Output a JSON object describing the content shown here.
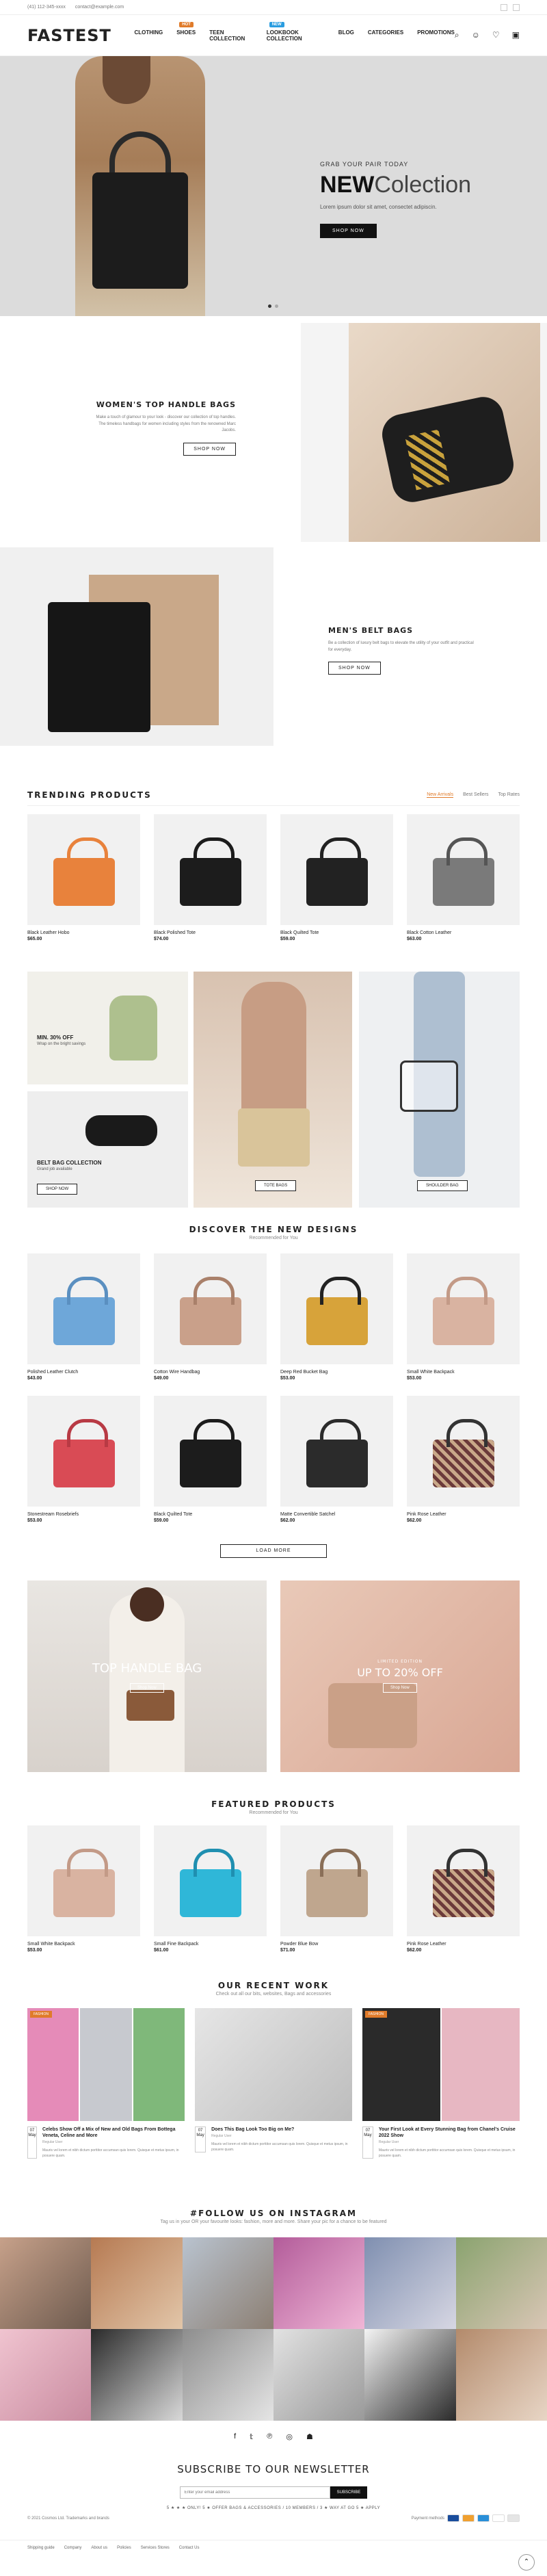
{
  "topbar": {
    "phone": "(41) 112-345-xxxx",
    "email": "contact@example.com"
  },
  "header": {
    "logo": "FASTEST",
    "nav": [
      {
        "label": "Clothing",
        "badge": ""
      },
      {
        "label": "Shoes",
        "badge": "HOT",
        "badge_color": "#e07b2a"
      },
      {
        "label": "Teen Collection",
        "badge": ""
      },
      {
        "label": "Lookbook Collection",
        "badge": "NEW",
        "badge_color": "#2a9de0"
      },
      {
        "label": "Blog",
        "badge": ""
      },
      {
        "label": "Categories",
        "badge": ""
      },
      {
        "label": "Promotions",
        "badge": ""
      }
    ],
    "icons": [
      "search-icon",
      "user-icon",
      "heart-icon",
      "cart-icon"
    ]
  },
  "hero": {
    "kicker": "GRAB YOUR PAIR TODAY",
    "title_bold": "NEW",
    "title_rest": "Colection",
    "text": "Lorem ipsum dolor sit amet, consectet adipiscin.",
    "button": "Shop Now"
  },
  "promo1": {
    "title": "WOMEN'S TOP HANDLE BAGS",
    "text": "Make a touch of glamour to your look - discover our collection of top handles. The timeless handbags for women including styles from the renowned Marc Jacobs.",
    "button": "Shop Now"
  },
  "promo2": {
    "title": "MEN'S BELT BAGS",
    "text": "Be a collection of luxury belt bags to elevate the utility of your outfit and practical for everyday.",
    "button": "Shop Now"
  },
  "trending": {
    "title": "TRENDING PRODUCTS",
    "tabs": [
      "New Arrivals",
      "Best Sellers",
      "Top Rates"
    ],
    "products": [
      {
        "name": "Black Leather Hobo",
        "price": "$65.00",
        "color": "#e8823c"
      },
      {
        "name": "Black Polished Tote",
        "price": "$74.00",
        "color": "#1c1c1c"
      },
      {
        "name": "Black Quilted Tote",
        "price": "$59.00",
        "color": "#222222"
      },
      {
        "name": "Black Cotton Leather",
        "price": "$63.00",
        "color": "#7a7a7a"
      }
    ]
  },
  "mosaic": {
    "tile1": {
      "title": "MIN. 30% OFF",
      "sub": "Wrap on the bright savings"
    },
    "tile2": {
      "title": "BELT BAG COLLECTION",
      "sub": "Grand job available",
      "button": "Shop Now"
    },
    "tile3": {
      "button": "Tote Bags"
    },
    "tile4": {
      "button": "Shoulder Bag"
    }
  },
  "discover": {
    "title": "DISCOVER THE NEW DESIGNS",
    "subtitle": "Recommended for You",
    "products": [
      {
        "name": "Polished Leather Clutch",
        "price": "$43.00",
        "color": "#6ea7d9"
      },
      {
        "name": "Cotton Wire Handbag",
        "price": "$49.00",
        "color": "#c9a08a"
      },
      {
        "name": "Deep Red Bucket Bag",
        "price": "$53.00",
        "color": "#d7a33a"
      },
      {
        "name": "Small White Backpack",
        "price": "$53.00",
        "color": "#d9b3a1"
      },
      {
        "name": "Stonestream Rosebriefs",
        "price": "$53.00",
        "color": "#d94b55"
      },
      {
        "name": "Black Quilted Tote",
        "price": "$59.00",
        "color": "#1c1c1c"
      },
      {
        "name": "Matte Convertible Satchel",
        "price": "$62.00",
        "color": "#2b2b2b"
      },
      {
        "name": "Pink Rose Leather",
        "price": "$62.00",
        "color": "#6b3a3a"
      }
    ],
    "load_more": "Load More"
  },
  "banners": {
    "left": {
      "title": "TOP HANDLE BAG",
      "button": "Shop Now"
    },
    "right": {
      "kicker": "LIMITED EDITION",
      "title": "UP TO 20% OFF",
      "button": "Shop Now"
    }
  },
  "featured": {
    "title": "FEATURED PRODUCTS",
    "subtitle": "Recommended for You",
    "products": [
      {
        "name": "Small White Backpack",
        "price": "$53.00",
        "color": "#d9b3a1"
      },
      {
        "name": "Small Fine Backpack",
        "price": "$61.00",
        "color": "#2fb7d8"
      },
      {
        "name": "Powder Blue Bow",
        "price": "$71.00",
        "color": "#bfa68e"
      },
      {
        "name": "Pink Rose Leather",
        "price": "$62.00",
        "color": "#6b3a3a"
      }
    ]
  },
  "blog": {
    "title": "OUR RECENT WORK",
    "subtitle": "Check out all our bits, websites, Bags and accessories",
    "posts": [
      {
        "tag": "FASHION",
        "day": "07",
        "month": "May",
        "title": "Celebs Show Off a Mix of New and Old Bags From Bottega Veneta, Celine and More",
        "by": "Regular User",
        "excerpt": "Mauris vel lorem et nibh dictum porttitor accumsan quis lorem. Quisque et metus ipsum, in posuere quam."
      },
      {
        "tag": "",
        "day": "07",
        "month": "May",
        "title": "Does This Bag Look Too Big on Me?",
        "by": "Regular User",
        "excerpt": "Mauris vel lorem et nibh dictum porttitor accumsan quis lorem. Quisque et metus ipsum, in posuere quam."
      },
      {
        "tag": "FASHION",
        "day": "07",
        "month": "May",
        "title": "Your First Look at Every Stunning Bag from Chanel's Cruise 2022 Show",
        "by": "Regular User",
        "excerpt": "Mauris vel lorem et nibh dictum porttitor accumsan quis lorem. Quisque et metus ipsum, in posuere quam."
      }
    ]
  },
  "instagram": {
    "title": "#FOLLOW US ON INSTAGRAM",
    "subtitle": "Tag us in your OR your favourite looks: fashion, more and more. Share your pic for a chance to be featured"
  },
  "social": [
    "facebook-icon",
    "twitter-icon",
    "pinterest-icon",
    "instagram-icon",
    "snapchat-icon"
  ],
  "newsletter": {
    "title": "SUBSCRIBE TO OUR NEWSLETTER",
    "placeholder": "Enter your email address",
    "button": "Subscribe",
    "note": "5 ★ ★ ★ ONLY! 5 ★ OFFER BAGS & ACCESSORIES / 10 MEMBERS / 3 ★ WAY AT GO 5 ★ APPLY"
  },
  "footer": {
    "copyright": "© 2021 Cosmos Ltd. Trademarks and brands",
    "payment_label": "Payment methods",
    "links": [
      "Shipping guide",
      "Company",
      "About us",
      "Policies",
      "Services Stores",
      "Contact Us"
    ]
  },
  "colors": {
    "accent": "#e07b2a"
  }
}
